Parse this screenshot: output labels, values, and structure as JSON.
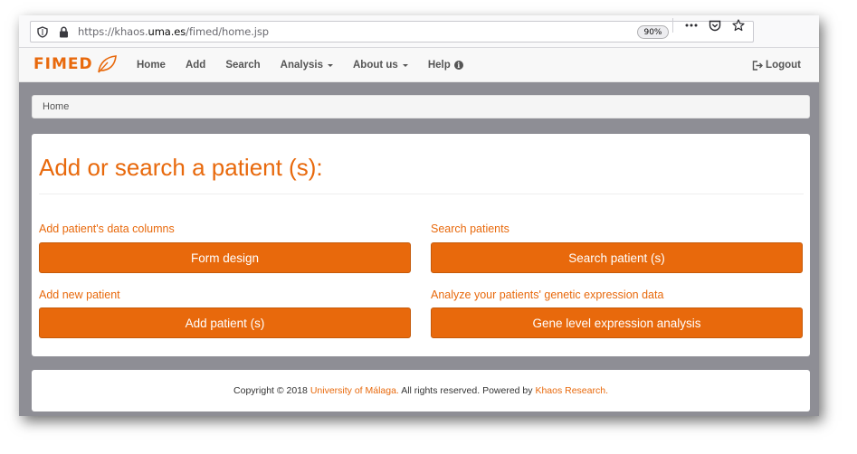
{
  "browser": {
    "url_prefix": "https://khaos.",
    "url_domain": "uma.es",
    "url_path": "/fimed/home.jsp",
    "zoom": "90%",
    "icons": [
      "shield-icon",
      "lock-icon",
      "more-icon",
      "pocket-icon",
      "bookmark-star-icon"
    ]
  },
  "navbar": {
    "brand": "FIMED",
    "items": [
      {
        "label": "Home"
      },
      {
        "label": "Add"
      },
      {
        "label": "Search"
      },
      {
        "label": "Analysis"
      },
      {
        "label": "About us"
      },
      {
        "label": "Help"
      }
    ],
    "logout": "Logout"
  },
  "breadcrumb": {
    "current": "Home"
  },
  "main": {
    "title": "Add or search a patient (s):",
    "sections": [
      {
        "label": "Add patient's data columns",
        "button": "Form design"
      },
      {
        "label": "Search patients",
        "button": "Search patient (s)"
      },
      {
        "label": "Add new patient",
        "button": "Add patient (s)"
      },
      {
        "label": "Analyze your patients' genetic expression data",
        "button": "Gene level expression analysis"
      }
    ]
  },
  "footer": {
    "prefix": "Copyright © 2018 ",
    "university_link": "University of Málaga.",
    "middle": " All rights reserved. Powered by ",
    "khaos_link": "Khaos Research."
  },
  "colors": {
    "accent": "#e8690c",
    "window_bg": "#8e8e95"
  }
}
